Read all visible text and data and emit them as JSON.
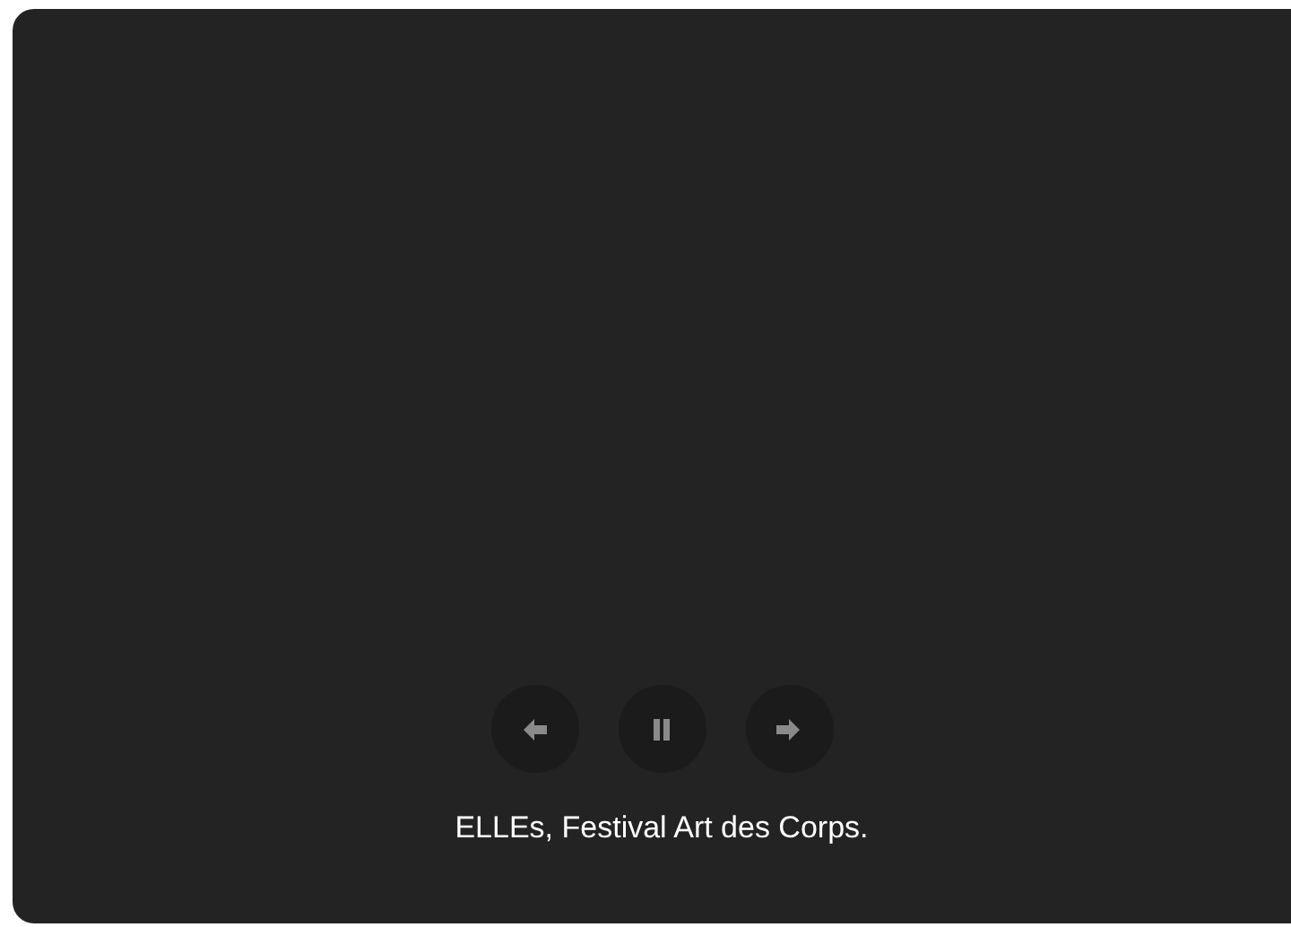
{
  "slideshow": {
    "controls": [
      {
        "kind": "previous"
      },
      {
        "kind": "pause"
      },
      {
        "kind": "next"
      }
    ],
    "caption": "ELLEs, Festival Art des Corps."
  }
}
